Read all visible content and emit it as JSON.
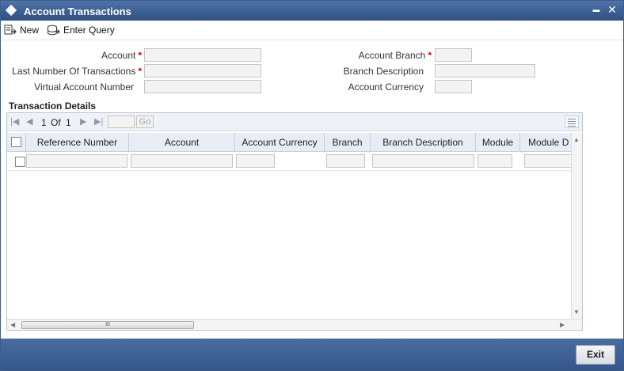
{
  "window": {
    "title": "Account Transactions",
    "minimize_glyph": "▬",
    "close_glyph": "✕"
  },
  "toolbar": {
    "new_label": "New",
    "enter_query_label": "Enter Query"
  },
  "form": {
    "account_label": "Account",
    "last_number_label": "Last Number Of Transactions",
    "virtual_account_label": "Virtual Account Number",
    "account_branch_label": "Account Branch",
    "branch_description_label": "Branch Description",
    "account_currency_label": "Account Currency",
    "required_marker": "*",
    "account_value": "",
    "last_number_value": "",
    "virtual_account_value": "",
    "account_branch_value": "",
    "branch_description_value": "",
    "account_currency_value": ""
  },
  "transaction_details": {
    "title": "Transaction Details",
    "pager": {
      "current": "1",
      "of_label": "Of",
      "total": "1",
      "go_label": "Go"
    },
    "columns": [
      "Reference Number",
      "Account",
      "Account Currency",
      "Branch",
      "Branch Description",
      "Module",
      "Module D"
    ],
    "hscroll_grip": "III"
  },
  "footer": {
    "exit_label": "Exit"
  },
  "colors": {
    "titlebar": "#3a5d92",
    "footer": "#3f6196",
    "required": "#dd0000"
  }
}
